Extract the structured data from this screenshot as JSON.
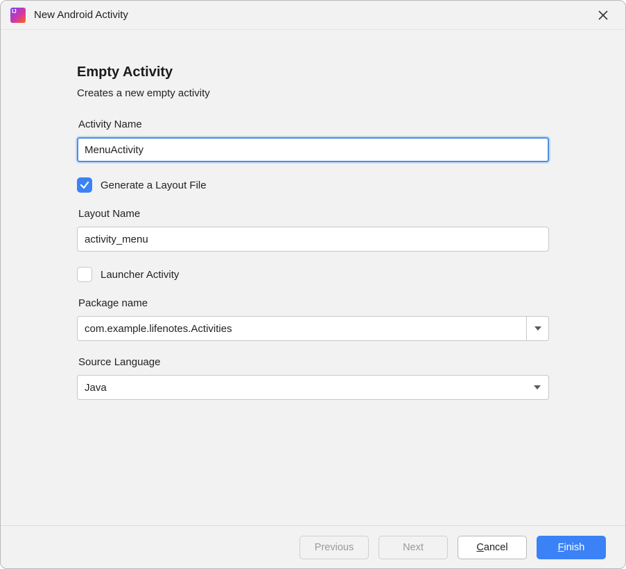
{
  "window": {
    "title": "New Android Activity"
  },
  "heading": "Empty Activity",
  "subtext": "Creates a new empty activity",
  "fields": {
    "activityName": {
      "label": "Activity Name",
      "value": "MenuActivity"
    },
    "generateLayout": {
      "label": "Generate a Layout File",
      "checked": true
    },
    "layoutName": {
      "label": "Layout Name",
      "value": "activity_menu"
    },
    "launcherActivity": {
      "label": "Launcher Activity",
      "checked": false
    },
    "packageName": {
      "label": "Package name",
      "value": "com.example.lifenotes.Activities"
    },
    "sourceLanguage": {
      "label": "Source Language",
      "value": "Java"
    }
  },
  "buttons": {
    "previous": "Previous",
    "next": "Next",
    "cancel": "Cancel",
    "finish": "Finish"
  }
}
